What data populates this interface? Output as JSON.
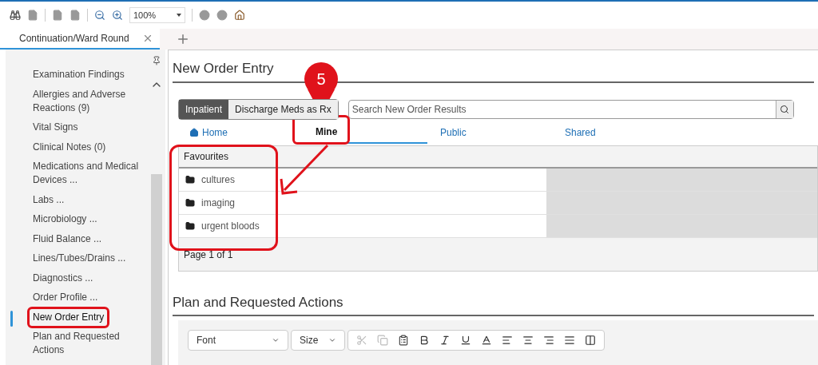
{
  "toolbar": {
    "zoom": "100%"
  },
  "tabs": [
    {
      "label": "Continuation/Ward Round",
      "selected": true
    }
  ],
  "sidebar": {
    "items": [
      {
        "label": "Examination Findings",
        "selected": false
      },
      {
        "label": "Allergies and Adverse Reactions (9)",
        "selected": false
      },
      {
        "label": "Vital Signs",
        "selected": false
      },
      {
        "label": "Clinical Notes (0)",
        "selected": false
      },
      {
        "label": "Medications and Medical Devices ...",
        "selected": false
      },
      {
        "label": "Labs ...",
        "selected": false
      },
      {
        "label": "Microbiology ...",
        "selected": false
      },
      {
        "label": "Fluid Balance ...",
        "selected": false
      },
      {
        "label": "Lines/Tubes/Drains ...",
        "selected": false
      },
      {
        "label": "Diagnostics ...",
        "selected": false
      },
      {
        "label": "Order Profile ...",
        "selected": false
      },
      {
        "label": "New Order Entry",
        "selected": true
      },
      {
        "label": "Plan and Requested Actions",
        "selected": false
      }
    ]
  },
  "order_entry": {
    "title": "New Order Entry",
    "modes": [
      {
        "label": "Inpatient",
        "selected": true
      },
      {
        "label": "Discharge Meds as Rx",
        "selected": false
      }
    ],
    "search": {
      "placeholder": "Search New Order Results"
    },
    "nav_tabs": [
      {
        "label": "Home",
        "kind": "home",
        "selected": false
      },
      {
        "label": "Mine",
        "kind": "plain",
        "selected": true
      },
      {
        "label": "Public",
        "kind": "plain",
        "selected": false
      },
      {
        "label": "Shared",
        "kind": "plain",
        "selected": false
      }
    ],
    "folder_header": "Favourites",
    "folders": [
      "cultures",
      "imaging",
      "urgent bloods"
    ],
    "pager": "Page 1 of 1"
  },
  "plan": {
    "title": "Plan and Requested Actions",
    "font": "Font",
    "size": "Size"
  },
  "annotation": {
    "step": "5"
  }
}
